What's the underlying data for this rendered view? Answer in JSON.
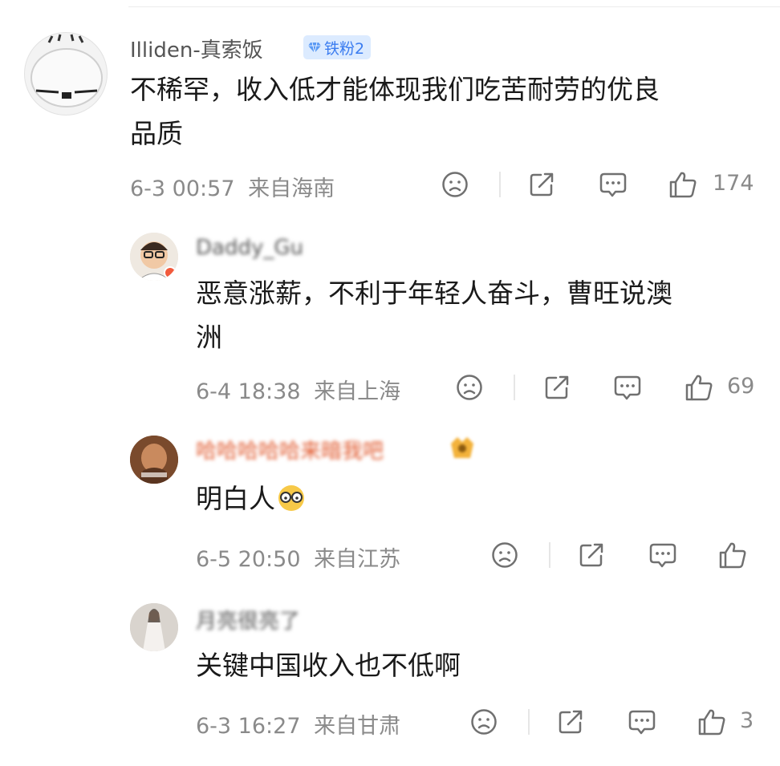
{
  "comments": [
    {
      "user": "Illiden-真索饭",
      "badge": "铁粉2",
      "text_lines": [
        "不稀罕，收入低才能体现我们吃苦耐劳的优良",
        "品质"
      ],
      "time": "6-3 00:57",
      "location": "来自海南",
      "likes": "174"
    },
    {
      "user": "Daddy_Gu",
      "text_lines": [
        "恶意涨薪，不利于年轻人奋斗，曹旺说澳",
        "洲"
      ],
      "time": "6-4 18:38",
      "location": "来自上海",
      "likes": "69"
    },
    {
      "user": "哈哈哈哈哈来暗我吧",
      "text_lines": [
        "明白人"
      ],
      "time": "6-5 20:50",
      "location": "来自江苏",
      "likes": ""
    },
    {
      "user": "月亮很亮了",
      "text_lines": [
        "关键中国收入也不低啊"
      ],
      "time": "6-3 16:27",
      "location": "来自甘肃",
      "likes": "3"
    }
  ],
  "icons": {
    "dislike": "frown-face-icon",
    "share": "share-icon",
    "reply": "comment-icon",
    "like": "thumbs-up-icon"
  },
  "colors": {
    "badge_bg": "#dcebff",
    "badge_text": "#3a7cf0",
    "meta_text": "#8a8a8a",
    "username_orange": "#e0572b"
  }
}
